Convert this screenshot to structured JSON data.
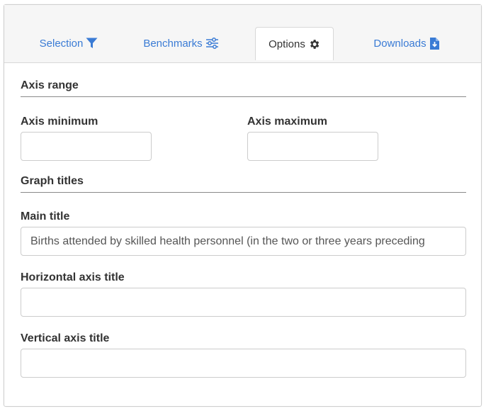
{
  "tabs": [
    {
      "label": "Selection",
      "icon": "filter-icon",
      "active": false
    },
    {
      "label": "Benchmarks",
      "icon": "sliders-icon",
      "active": false
    },
    {
      "label": "Options",
      "icon": "gear-icon",
      "active": true
    },
    {
      "label": "Downloads",
      "icon": "file-download-icon",
      "active": false
    }
  ],
  "colors": {
    "accent": "#3a7bd5",
    "text": "#333333",
    "border": "#cccccc"
  },
  "axis_range": {
    "title": "Axis range",
    "min_label": "Axis minimum",
    "min_value": "",
    "max_label": "Axis maximum",
    "max_value": ""
  },
  "graph_titles": {
    "title": "Graph titles",
    "main_label": "Main title",
    "main_value": "Births attended by skilled health personnel (in the two or three years preceding",
    "horizontal_label": "Horizontal axis title",
    "horizontal_value": "",
    "vertical_label": "Vertical axis title",
    "vertical_value": ""
  }
}
